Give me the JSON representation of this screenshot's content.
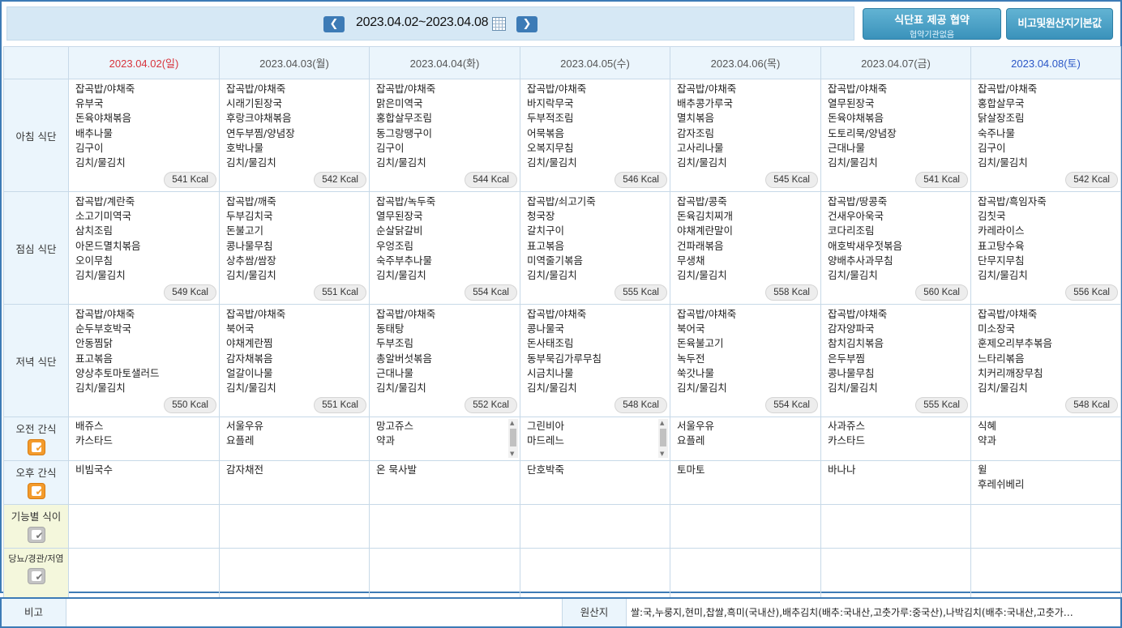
{
  "header": {
    "prev_icon": "chevron-left",
    "next_icon": "chevron-right",
    "date_range": "2023.04.02~2023.04.08",
    "calendar_icon": "calendar",
    "agreement_button": {
      "title": "식단표 제공 협약",
      "subtitle": "협약기관없음"
    },
    "origin_button": "비고및원산지기본값"
  },
  "days": [
    "2023.04.02(일)",
    "2023.04.03(월)",
    "2023.04.04(화)",
    "2023.04.05(수)",
    "2023.04.06(목)",
    "2023.04.07(금)",
    "2023.04.08(토)"
  ],
  "meals": [
    {
      "label": "아침 식단",
      "days": [
        {
          "items": "잡곡밥/야채죽\n유부국\n돈육야채볶음\n배추나물\n김구이\n김치/물김치",
          "kcal": "541 Kcal"
        },
        {
          "items": "잡곡밥/야채죽\n시래기된장국\n후랑크야채볶음\n연두부찜/양념장\n호박나물\n김치/물김치",
          "kcal": "542 Kcal"
        },
        {
          "items": "잡곡밥/야채죽\n맑은미역국\n홍합살무조림\n동그랑땡구이\n김구이\n김치/물김치",
          "kcal": "544 Kcal"
        },
        {
          "items": "잡곡밥/야채죽\n바지락무국\n두부적조림\n어묵볶음\n오복지무침\n김치/물김치",
          "kcal": "546 Kcal"
        },
        {
          "items": "잡곡밥/야채죽\n배추콩가루국\n멸치볶음\n감자조림\n고사리나물\n김치/물김치",
          "kcal": "545 Kcal"
        },
        {
          "items": "잡곡밥/야채죽\n열무된장국\n돈육야채볶음\n도토리묵/양념장\n근대나물\n김치/물김치",
          "kcal": "541 Kcal"
        },
        {
          "items": "잡곡밥/야채죽\n홍합살무국\n닭살장조림\n숙주나물\n김구이\n김치/물김치",
          "kcal": "542 Kcal"
        }
      ]
    },
    {
      "label": "점심 식단",
      "days": [
        {
          "items": "잡곡밥/계란죽\n소고기미역국\n삼치조림\n아몬드멸치볶음\n오이무침\n김치/물김치",
          "kcal": "549 Kcal"
        },
        {
          "items": "잡곡밥/깨죽\n두부김치국\n돈불고기\n콩나물무침\n상추쌈/쌈장\n김치/물김치",
          "kcal": "551 Kcal"
        },
        {
          "items": "잡곡밥/녹두죽\n열무된장국\n순살닭갈비\n우엉조림\n숙주부추나물\n김치/물김치",
          "kcal": "554 Kcal"
        },
        {
          "items": "잡곡밥/쇠고기죽\n청국장\n갈치구이\n표고볶음\n미역줄기볶음\n김치/물김치",
          "kcal": "555 Kcal"
        },
        {
          "items": "잡곡밥/콩죽\n돈육김치찌개\n야채계란말이\n건파래볶음\n무생채\n김치/물김치",
          "kcal": "558 Kcal"
        },
        {
          "items": "잡곡밥/땅콩죽\n건새우아욱국\n코다리조림\n애호박새우젓볶음\n양배추사과무침\n김치/물김치",
          "kcal": "560 Kcal"
        },
        {
          "items": "잡곡밥/흑임자죽\n김칫국\n카레라이스\n표고탕수육\n단무지무침\n김치/물김치",
          "kcal": "556 Kcal"
        }
      ]
    },
    {
      "label": "저녁 식단",
      "days": [
        {
          "items": "잡곡밥/야채죽\n순두부호박국\n안동찜닭\n표고볶음\n양상추토마토샐러드\n김치/물김치",
          "kcal": "550 Kcal"
        },
        {
          "items": "잡곡밥/야채죽\n북어국\n야채계란찜\n감자채볶음\n얼갈이나물\n김치/물김치",
          "kcal": "551 Kcal"
        },
        {
          "items": "잡곡밥/야채죽\n동태탕\n두부조림\n총알버섯볶음\n근대나물\n김치/물김치",
          "kcal": "552 Kcal"
        },
        {
          "items": "잡곡밥/야채죽\n콩나물국\n돈사태조림\n동부묵김가루무침\n시금치나물\n김치/물김치",
          "kcal": "548 Kcal"
        },
        {
          "items": "잡곡밥/야채죽\n북어국\n돈육불고기\n녹두전\n쑥갓나물\n김치/물김치",
          "kcal": "554 Kcal"
        },
        {
          "items": "잡곡밥/야채죽\n감자양파국\n참치김치볶음\n은두부찜\n콩나물무침\n김치/물김치",
          "kcal": "555 Kcal"
        },
        {
          "items": "잡곡밥/야채죽\n미소장국\n훈제오리부추볶음\n느타리볶음\n치커리깨장무침\n김치/물김치",
          "kcal": "548 Kcal"
        }
      ]
    }
  ],
  "snacks": [
    {
      "label": "오전 간식",
      "checkbox": "orange-check",
      "days": [
        "배쥬스\n카스타드",
        "서울우유\n요플레",
        "망고쥬스\n약과",
        "그린비아\n마드레느",
        "서울우유\n요플레",
        "사과쥬스\n카스타드",
        "식혜\n약과"
      ]
    },
    {
      "label": "오후 간식",
      "checkbox": "orange-check",
      "days": [
        "비빔국수",
        "감자채전",
        "온 묵사발",
        "단호박죽",
        "토마토",
        "바나나",
        "윌\n후레쉬베리"
      ]
    }
  ],
  "extra_rows": [
    {
      "label": "기능별 식이",
      "checkbox": "gray-check"
    },
    {
      "label": "당뇨/경관/저염",
      "checkbox": "gray-check"
    }
  ],
  "footer": {
    "note_label": "비고",
    "note_value": "",
    "origin_label": "원산지",
    "origin_value": "쌀:국,누룽지,현미,찹쌀,흑미(국내산),배추김치(배추:국내산,고춧가루:중국산),나박김치(배추:국내산,고춧가…"
  },
  "colors": {
    "accent": "#3d7bb6",
    "sunday": "#d8343c",
    "saturday": "#2a56c7",
    "check_orange": "#f39b2c"
  }
}
